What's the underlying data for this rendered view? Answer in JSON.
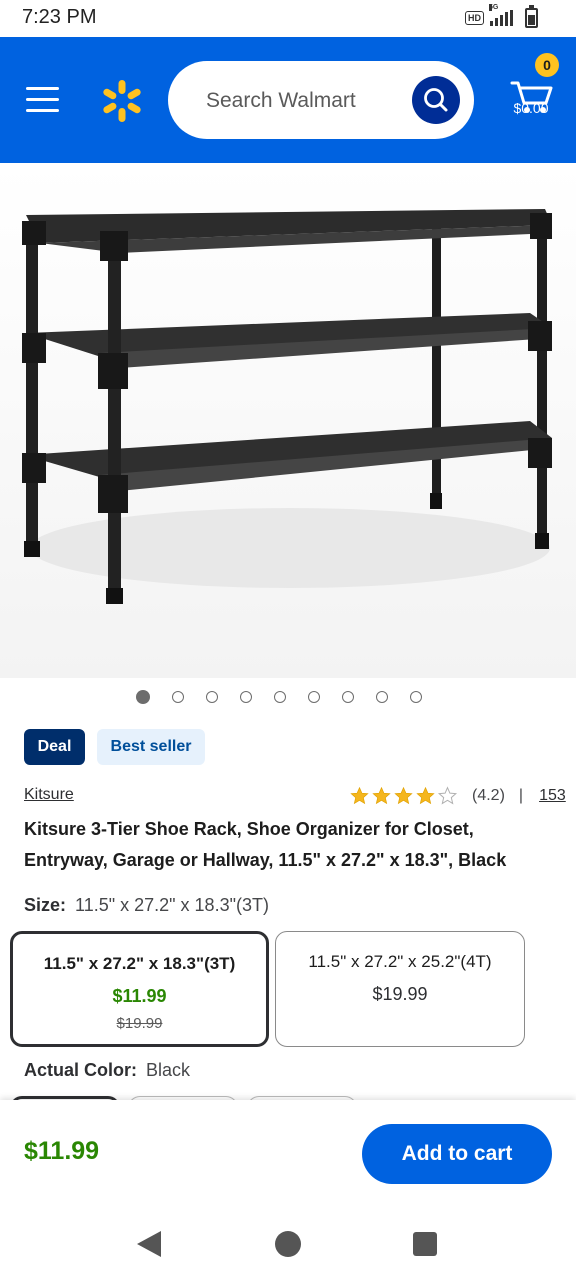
{
  "status_bar": {
    "time": "7:23 PM",
    "hd": "HD",
    "network": "5G"
  },
  "header": {
    "search_placeholder": "Search Walmart",
    "cart_count": "0",
    "cart_total": "$0.00",
    "brand_color": "#0062e0",
    "spark_color": "#ffc220"
  },
  "gallery": {
    "total_images": 9,
    "active_index": 0
  },
  "badges": {
    "deal": "Deal",
    "best_seller": "Best seller"
  },
  "product": {
    "brand": "Kitsure",
    "rating": 4.2,
    "rating_text": "(4.2)",
    "rating_sep": "|",
    "review_count": "153",
    "title": "Kitsure 3-Tier Shoe Rack, Shoe Organizer for Closet, Entryway, Garage or Hallway, 11.5\" x 27.2\" x 18.3\", Black"
  },
  "size": {
    "label": "Size:",
    "selected": "11.5\" x 27.2\" x 18.3\"(3T)",
    "options": [
      {
        "name": "11.5\" x 27.2\" x 18.3\"(3T)",
        "price": "$11.99",
        "was": "$19.99"
      },
      {
        "name": "11.5\" x 27.2\" x 25.2\"(4T)",
        "price": "$19.99"
      }
    ]
  },
  "color": {
    "label": "Actual Color:",
    "selected": "Black"
  },
  "bottom": {
    "price": "$11.99",
    "add_to_cart": "Add to cart"
  }
}
